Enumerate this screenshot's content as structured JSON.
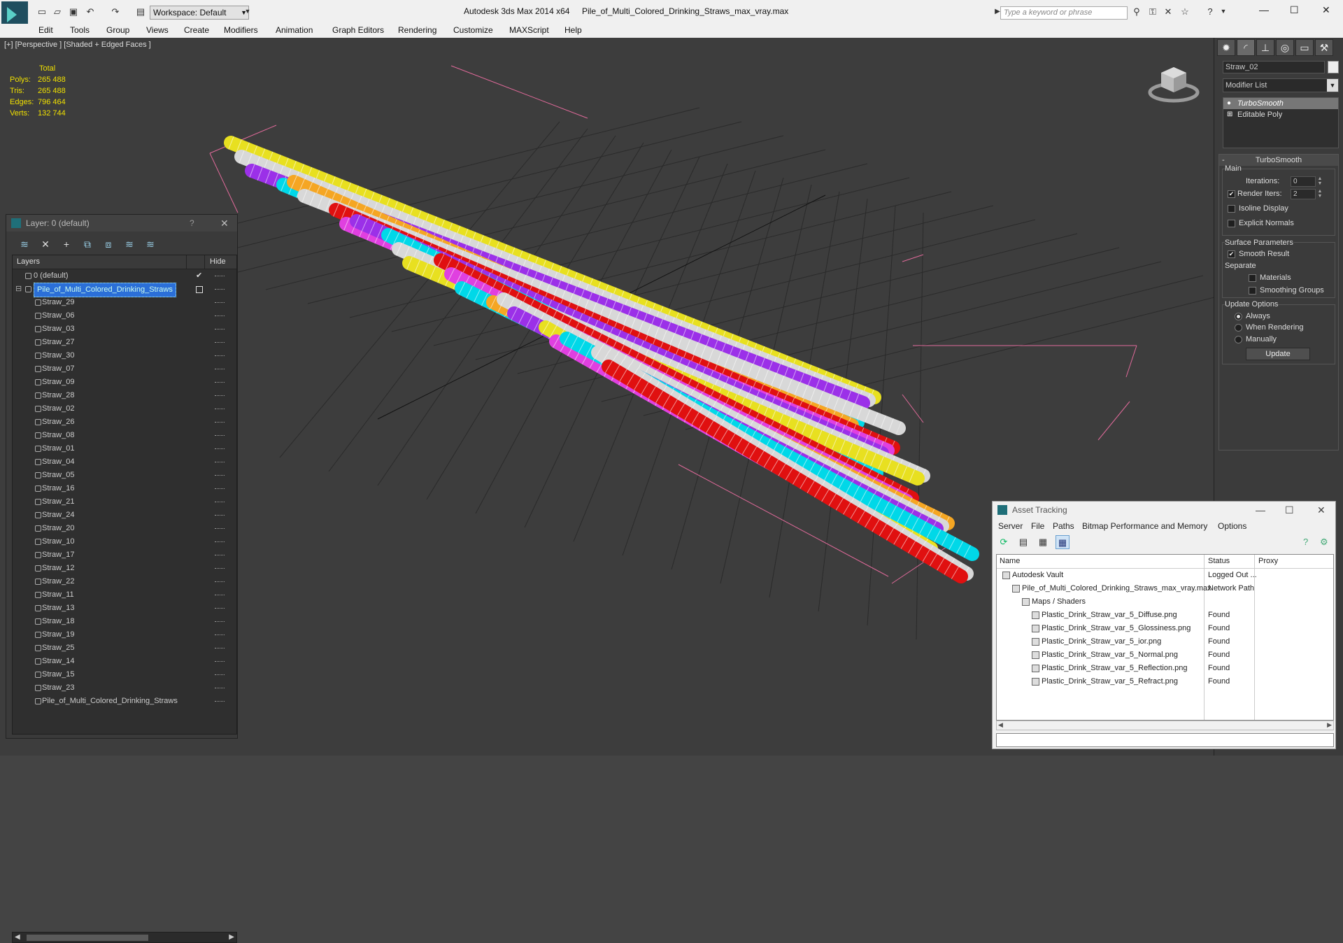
{
  "app": {
    "title": "Autodesk 3ds Max  2014 x64",
    "file": "Pile_of_Multi_Colored_Drinking_Straws_max_vray.max",
    "workspace": "Workspace: Default",
    "search_placeholder": "Type a keyword or phrase"
  },
  "menu": [
    "Edit",
    "Tools",
    "Group",
    "Views",
    "Create",
    "Modifiers",
    "Animation",
    "Graph Editors",
    "Rendering",
    "Customize",
    "MAXScript",
    "Help"
  ],
  "viewport": {
    "label": "[+] [Perspective ] [Shaded + Edged Faces ]",
    "stats": {
      "header": "Total",
      "rows": [
        {
          "k": "Polys:",
          "v": "265 488"
        },
        {
          "k": "Tris:",
          "v": "265 488"
        },
        {
          "k": "Edges:",
          "v": "796 464"
        },
        {
          "k": "Verts:",
          "v": "132 744"
        }
      ]
    },
    "straw_colors": [
      "#f5a623",
      "#00d8e8",
      "#e040e0",
      "#d8d8d8",
      "#e8e020",
      "#e01010",
      "#9b30e8"
    ]
  },
  "command_panel": {
    "object_name": "Straw_02",
    "modifier_list": "Modifier List",
    "stack": [
      "TurboSmooth",
      "Editable Poly"
    ],
    "rollout_title": "TurboSmooth",
    "main_label": "Main",
    "iterations_label": "Iterations:",
    "iterations_value": "0",
    "render_iters_label": "Render Iters:",
    "render_iters_value": "2",
    "isoline_label": "Isoline Display",
    "explicit_normals_label": "Explicit Normals",
    "surface_params_label": "Surface Parameters",
    "smooth_result_label": "Smooth Result",
    "separate_label": "Separate",
    "materials_label": "Materials",
    "smoothing_groups_label": "Smoothing Groups",
    "update_options_label": "Update Options",
    "always_label": "Always",
    "when_rendering_label": "When Rendering",
    "manually_label": "Manually",
    "update_button": "Update"
  },
  "layer_panel": {
    "title": "Layer: 0 (default)",
    "col_layers": "Layers",
    "col_hide": "Hide",
    "default_layer": "0 (default)",
    "selected_layer": "Pile_of_Multi_Colored_Drinking_Straws",
    "items": [
      "Straw_29",
      "Straw_06",
      "Straw_03",
      "Straw_27",
      "Straw_30",
      "Straw_07",
      "Straw_09",
      "Straw_28",
      "Straw_02",
      "Straw_26",
      "Straw_08",
      "Straw_01",
      "Straw_04",
      "Straw_05",
      "Straw_16",
      "Straw_21",
      "Straw_24",
      "Straw_20",
      "Straw_10",
      "Straw_17",
      "Straw_12",
      "Straw_22",
      "Straw_11",
      "Straw_13",
      "Straw_18",
      "Straw_19",
      "Straw_25",
      "Straw_14",
      "Straw_15",
      "Straw_23",
      "Pile_of_Multi_Colored_Drinking_Straws"
    ]
  },
  "asset_panel": {
    "title": "Asset Tracking",
    "menu": [
      "Server",
      "File",
      "Paths",
      "Bitmap Performance and Memory",
      "Options"
    ],
    "columns": [
      "Name",
      "Status",
      "Proxy"
    ],
    "rows": [
      {
        "name": "Autodesk Vault",
        "status": "Logged Out ...",
        "indent": 0
      },
      {
        "name": "Pile_of_Multi_Colored_Drinking_Straws_max_vray.max",
        "status": "Network Path",
        "indent": 1
      },
      {
        "name": "Maps / Shaders",
        "status": "",
        "indent": 2
      },
      {
        "name": "Plastic_Drink_Straw_var_5_Diffuse.png",
        "status": "Found",
        "indent": 3
      },
      {
        "name": "Plastic_Drink_Straw_var_5_Glossiness.png",
        "status": "Found",
        "indent": 3
      },
      {
        "name": "Plastic_Drink_Straw_var_5_ior.png",
        "status": "Found",
        "indent": 3
      },
      {
        "name": "Plastic_Drink_Straw_var_5_Normal.png",
        "status": "Found",
        "indent": 3
      },
      {
        "name": "Plastic_Drink_Straw_var_5_Reflection.png",
        "status": "Found",
        "indent": 3
      },
      {
        "name": "Plastic_Drink_Straw_var_5_Refract.png",
        "status": "Found",
        "indent": 3
      }
    ]
  }
}
